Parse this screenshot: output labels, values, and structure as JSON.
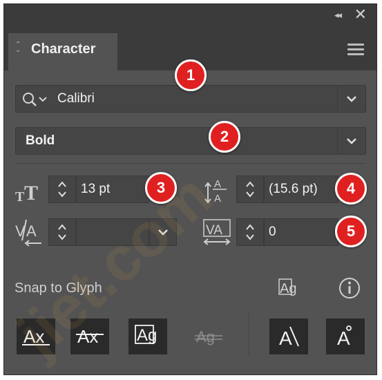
{
  "panel": {
    "tab_label": "Character",
    "font_family": "Calibri",
    "font_style": "Bold",
    "font_size": "13 pt",
    "leading": "(15.6 pt)",
    "kerning": "",
    "tracking": "0",
    "snap_label": "Snap to Glyph"
  },
  "glyph_buttons": {
    "b1": "Ax",
    "b2": "Ax",
    "b3": "Ag",
    "b4": "Ag",
    "b5": "A",
    "b6": "A"
  },
  "glyph_toggle": "Ag",
  "badges": [
    "1",
    "2",
    "3",
    "4",
    "5"
  ],
  "colors": {
    "panel": "#535353",
    "header": "#3b3b3b",
    "field": "#454545",
    "badge": "#e02020"
  }
}
